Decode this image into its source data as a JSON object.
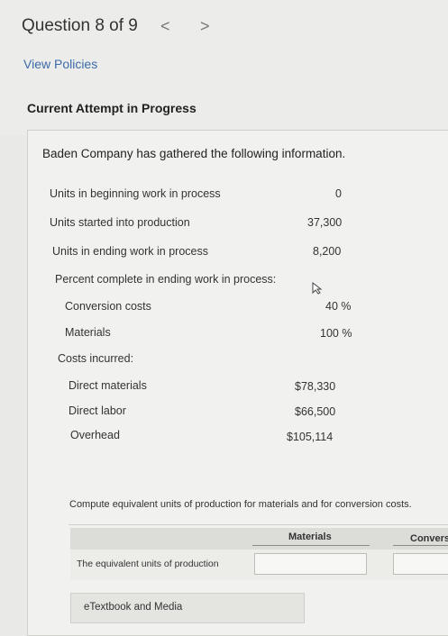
{
  "header": {
    "question_label": "Question 8 of 9",
    "prev_glyph": "<",
    "next_glyph": ">",
    "view_policies": "View Policies",
    "attempt_status": "Current Attempt in Progress"
  },
  "problem": {
    "intro": "Baden Company has gathered the following information.",
    "rows": [
      {
        "label": "Units in beginning work in process",
        "value": "0"
      },
      {
        "label": "Units started into production",
        "value": "37,300"
      },
      {
        "label": "Units in ending work in process",
        "value": "8,200"
      },
      {
        "label": "Percent complete in ending work in process:",
        "value": ""
      },
      {
        "label": "Conversion costs",
        "value": "40  %"
      },
      {
        "label": "Materials",
        "value": "100  %"
      },
      {
        "label": "Costs incurred:",
        "value": ""
      },
      {
        "label": "Direct materials",
        "value": "$78,330"
      },
      {
        "label": "Direct labor",
        "value": "$66,500"
      },
      {
        "label": "Overhead",
        "value": "$105,114"
      }
    ]
  },
  "question": {
    "instruction": "Compute equivalent units of production for materials and for conversion costs.",
    "columns": [
      "Materials",
      "Convers"
    ],
    "row_label": "The equivalent units of production",
    "materials_value": "",
    "conversion_value": ""
  },
  "footer": {
    "etextbook": "eTextbook and Media"
  }
}
